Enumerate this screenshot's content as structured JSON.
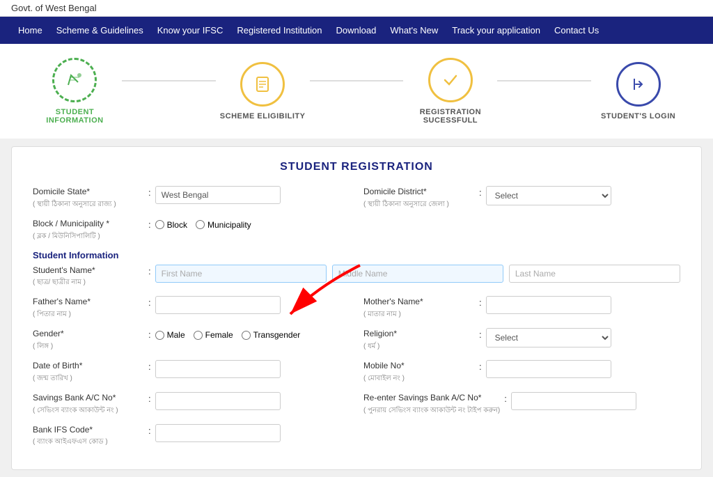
{
  "topbar": {
    "title": "Govt. of West Bengal"
  },
  "nav": {
    "items": [
      {
        "label": "Home",
        "id": "home"
      },
      {
        "label": "Scheme & Guidelines",
        "id": "scheme"
      },
      {
        "label": "Know your IFSC",
        "id": "ifsc"
      },
      {
        "label": "Registered Institution",
        "id": "institution"
      },
      {
        "label": "Download",
        "id": "download"
      },
      {
        "label": "What's New",
        "id": "whats-new"
      },
      {
        "label": "Track your application",
        "id": "track"
      },
      {
        "label": "Contact Us",
        "id": "contact"
      }
    ]
  },
  "steps": [
    {
      "label": "STUDENT INFORMATION",
      "icon": "✎",
      "state": "active"
    },
    {
      "label": "SCHEME ELIGIBILITY",
      "icon": "📄",
      "state": "pending"
    },
    {
      "label": "REGISTRATION SUCESSFULL",
      "icon": "✔",
      "state": "pending"
    },
    {
      "label": "STUDENT'S LOGIN",
      "icon": "➤",
      "state": "dark"
    }
  ],
  "form": {
    "title": "STUDENT REGISTRATION",
    "domicile_state_label": "Domicile State*",
    "domicile_state_sublabel": "( স্থায়ী ঠিকানা অনুসারে রাজ্য )",
    "domicile_state_value": "West Bengal",
    "domicile_district_label": "Domicile District*",
    "domicile_district_sublabel": "( স্থায়ী ঠিকানা অনুসারে জেলা )",
    "domicile_district_placeholder": "Select",
    "block_label": "Block / Municipality *",
    "block_sublabel": "( ব্লক / মিউনিসিপালিটি )",
    "block_options": [
      "Block",
      "Municipality"
    ],
    "student_info_title": "Student Information",
    "student_name_label": "Student's Name*",
    "student_name_sublabel": "( ছাত্র/ ছাত্রীর নাম )",
    "first_name_placeholder": "First Name",
    "middle_name_placeholder": "Middle Name",
    "last_name_placeholder": "Last Name",
    "father_name_label": "Father's Name*",
    "father_name_sublabel": "( পিতার নাম )",
    "mother_name_label": "Mother's Name*",
    "mother_name_sublabel": "( মাতার নাম )",
    "gender_label": "Gender*",
    "gender_sublabel": "( লিঙ্গ )",
    "gender_options": [
      "Male",
      "Female",
      "Transgender"
    ],
    "religion_label": "Religion*",
    "religion_sublabel": "( ধর্ম )",
    "religion_placeholder": "Select",
    "dob_label": "Date of Birth*",
    "dob_sublabel": "( জন্ম তারিখ )",
    "mobile_label": "Mobile No*",
    "mobile_sublabel": "( মোবাইল নং )",
    "savings_label": "Savings Bank A/C No*",
    "savings_sublabel": "( সেভিংস ব্যাংক আকাউন্ট নং )",
    "re_savings_label": "Re-enter Savings Bank A/C No*",
    "re_savings_sublabel": "( পুনরায় সেভিংস ব্যাংক আকাউন্ট নং টাইপ করুন)",
    "bank_ifs_label": "Bank IFS Code*",
    "bank_ifs_sublabel": "( ব্যাংক আইএফএস কোড )"
  }
}
